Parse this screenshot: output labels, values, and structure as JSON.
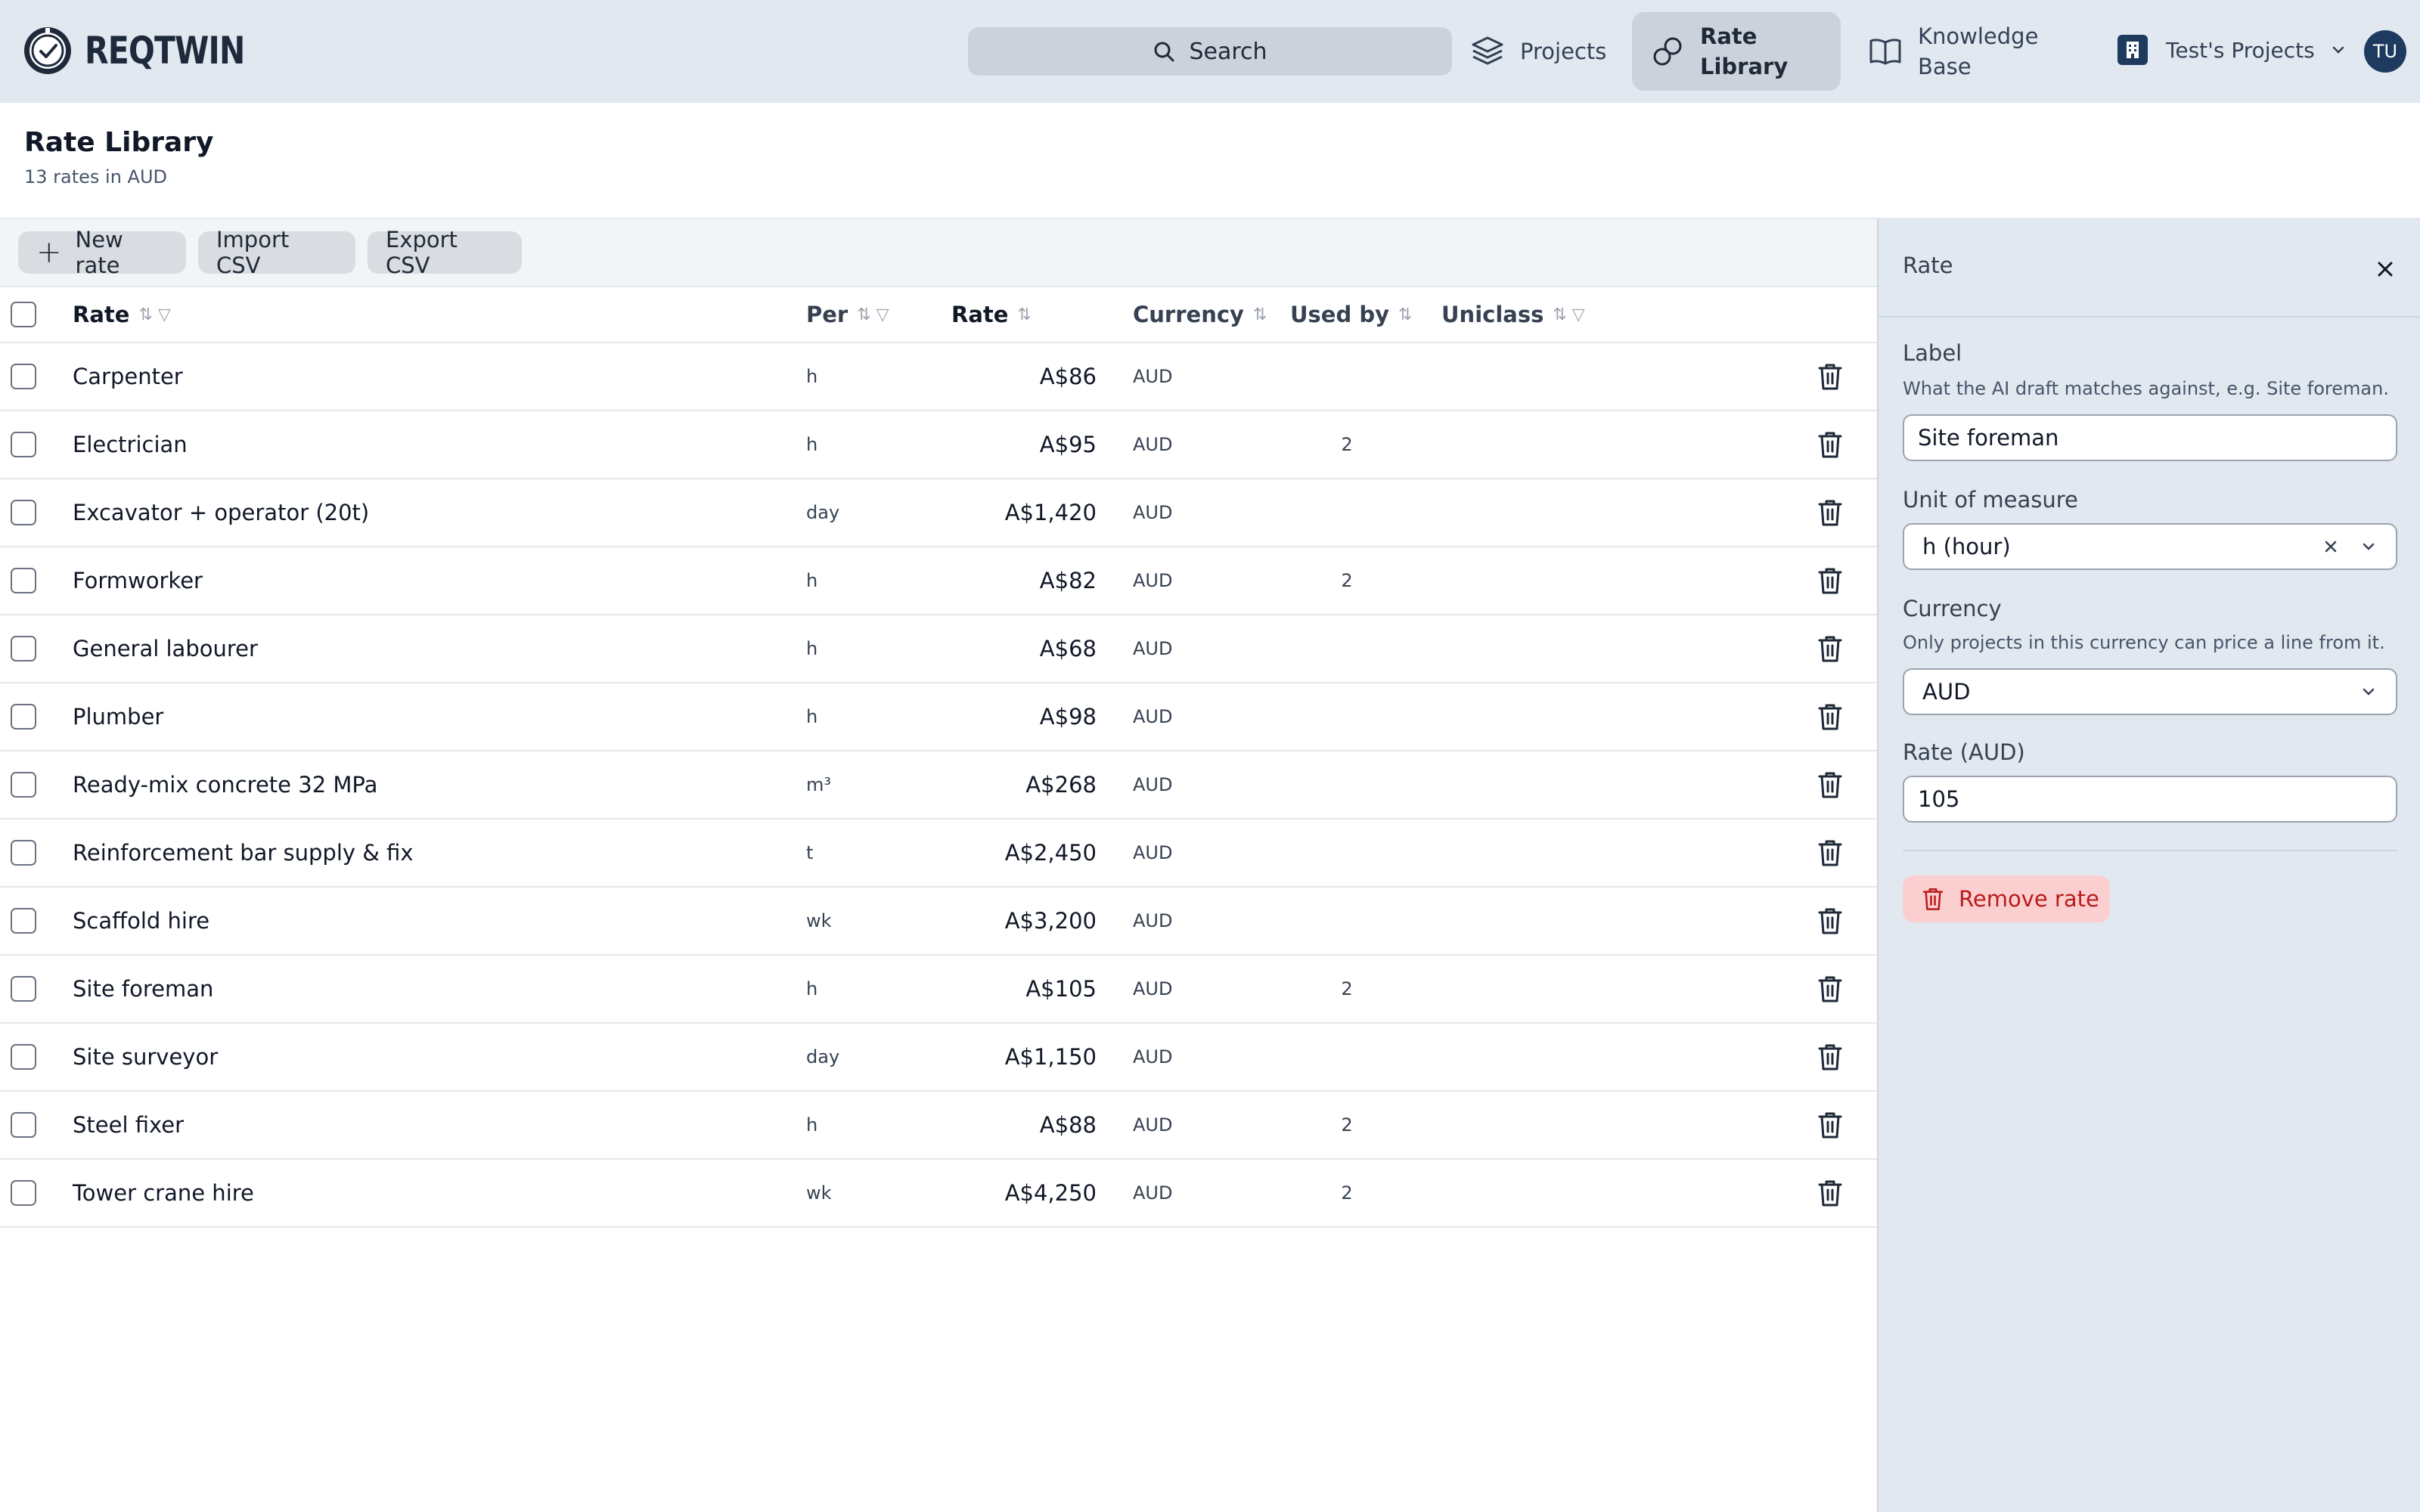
{
  "brand": {
    "name": "REQTWIN"
  },
  "nav": {
    "search_label": "Search",
    "projects_label": "Projects",
    "rate_library_line1": "Rate",
    "rate_library_line2": "Library",
    "knowledge_line1": "Knowledge",
    "knowledge_line2": "Base",
    "workspace_label": "Test's Projects",
    "avatar_initials": "TU"
  },
  "page": {
    "title": "Rate Library",
    "subtitle": "13 rates in AUD"
  },
  "toolbar": {
    "new_label": "New rate",
    "import_label": "Import CSV",
    "export_label": "Export CSV"
  },
  "table": {
    "headers": {
      "label": "Rate",
      "per": "Per",
      "rate": "Rate",
      "currency": "Currency",
      "used_by": "Used by",
      "uniclass": "Uniclass"
    },
    "rows": [
      {
        "label": "Carpenter",
        "per": "h",
        "rate": "A$86",
        "currency": "AUD",
        "used_by": "",
        "uniclass": ""
      },
      {
        "label": "Electrician",
        "per": "h",
        "rate": "A$95",
        "currency": "AUD",
        "used_by": "2",
        "uniclass": ""
      },
      {
        "label": "Excavator + operator (20t)",
        "per": "day",
        "rate": "A$1,420",
        "currency": "AUD",
        "used_by": "",
        "uniclass": ""
      },
      {
        "label": "Formworker",
        "per": "h",
        "rate": "A$82",
        "currency": "AUD",
        "used_by": "2",
        "uniclass": ""
      },
      {
        "label": "General labourer",
        "per": "h",
        "rate": "A$68",
        "currency": "AUD",
        "used_by": "",
        "uniclass": ""
      },
      {
        "label": "Plumber",
        "per": "h",
        "rate": "A$98",
        "currency": "AUD",
        "used_by": "",
        "uniclass": ""
      },
      {
        "label": "Ready-mix concrete 32 MPa",
        "per": "m³",
        "rate": "A$268",
        "currency": "AUD",
        "used_by": "",
        "uniclass": ""
      },
      {
        "label": "Reinforcement bar supply & fix",
        "per": "t",
        "rate": "A$2,450",
        "currency": "AUD",
        "used_by": "",
        "uniclass": ""
      },
      {
        "label": "Scaffold hire",
        "per": "wk",
        "rate": "A$3,200",
        "currency": "AUD",
        "used_by": "",
        "uniclass": ""
      },
      {
        "label": "Site foreman",
        "per": "h",
        "rate": "A$105",
        "currency": "AUD",
        "used_by": "2",
        "uniclass": ""
      },
      {
        "label": "Site surveyor",
        "per": "day",
        "rate": "A$1,150",
        "currency": "AUD",
        "used_by": "",
        "uniclass": ""
      },
      {
        "label": "Steel fixer",
        "per": "h",
        "rate": "A$88",
        "currency": "AUD",
        "used_by": "2",
        "uniclass": ""
      },
      {
        "label": "Tower crane hire",
        "per": "wk",
        "rate": "A$4,250",
        "currency": "AUD",
        "used_by": "2",
        "uniclass": ""
      }
    ]
  },
  "panel": {
    "title": "Rate",
    "label_field": {
      "label": "Label",
      "help": "What the AI draft matches against, e.g. Site foreman.",
      "value": "Site foreman"
    },
    "unit_field": {
      "label": "Unit of measure",
      "value": "h (hour)"
    },
    "currency_field": {
      "label": "Currency",
      "help": "Only projects in this currency can price a line from it.",
      "value": "AUD"
    },
    "rate_field": {
      "label": "Rate (AUD)",
      "value": "105"
    },
    "remove_label": "Remove rate"
  },
  "colors": {
    "topbar": "#e2e8f0",
    "panel": "#e2e8f0",
    "danger": "#b91c1c",
    "danger_bg": "#fbcfd0",
    "brand_dark": "#1e3a5f"
  }
}
